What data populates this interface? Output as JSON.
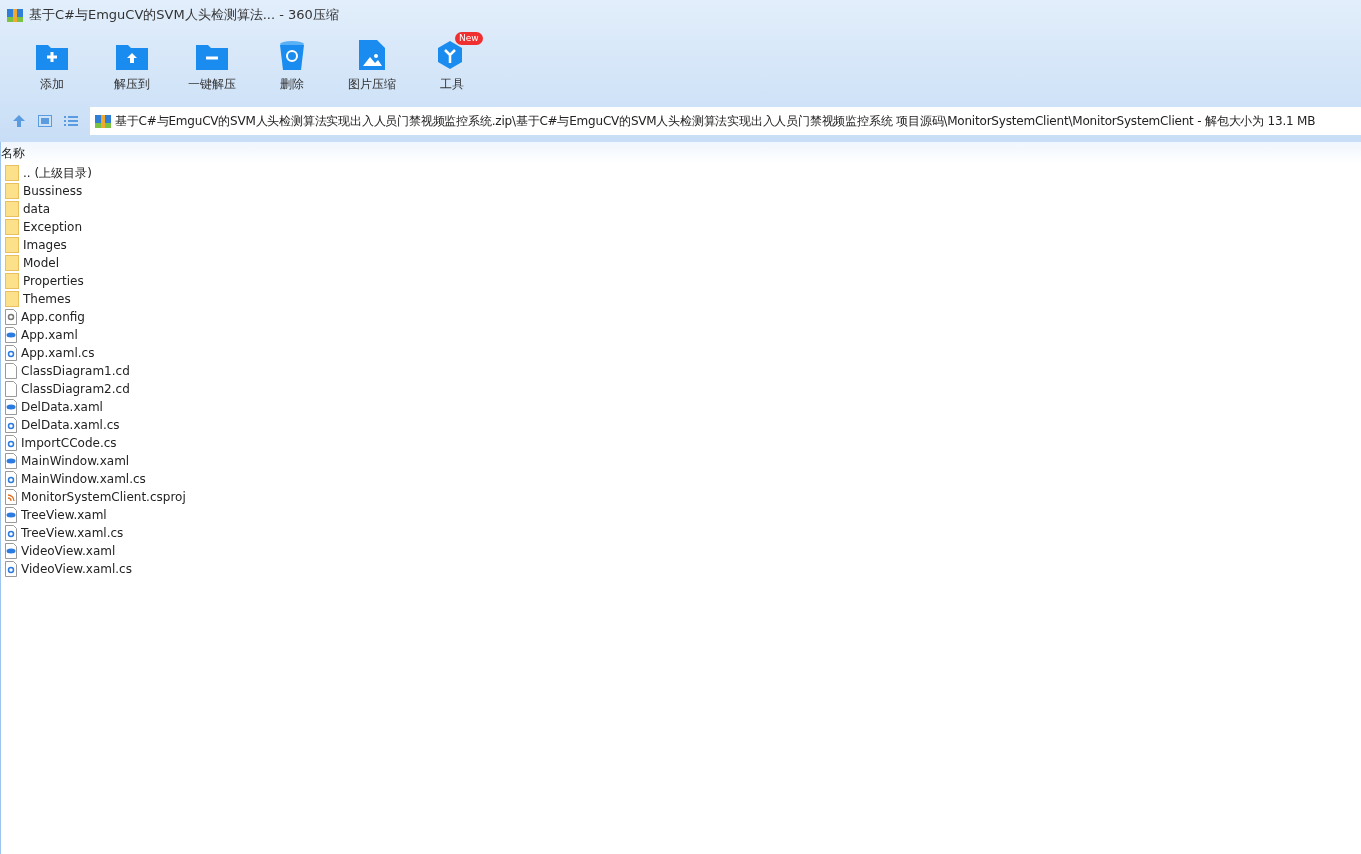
{
  "window": {
    "title": "基于C#与EmguCV的SVM人头检测算法... - 360压缩"
  },
  "toolbar": [
    {
      "kind": "add",
      "label": "添加"
    },
    {
      "kind": "extract",
      "label": "解压到"
    },
    {
      "kind": "oneclick",
      "label": "一键解压"
    },
    {
      "kind": "delete",
      "label": "删除"
    },
    {
      "kind": "image",
      "label": "图片压缩"
    },
    {
      "kind": "tools",
      "label": "工具",
      "badge": "New"
    }
  ],
  "address": {
    "path": "基于C#与EmguCV的SVM人头检测算法实现出入人员门禁视频监控系统.zip\\基于C#与EmguCV的SVM人头检测算法实现出入人员门禁视频监控系统 项目源码\\MonitorSystemClient\\MonitorSystemClient - 解包大小为 13.1 MB"
  },
  "table": {
    "columns": [
      "名称"
    ],
    "rows": [
      {
        "kind": "folder",
        "name": ".. (上级目录)"
      },
      {
        "kind": "folder",
        "name": "Bussiness"
      },
      {
        "kind": "folder",
        "name": "data"
      },
      {
        "kind": "folder",
        "name": "Exception"
      },
      {
        "kind": "folder",
        "name": "Images"
      },
      {
        "kind": "folder",
        "name": "Model"
      },
      {
        "kind": "folder",
        "name": "Properties"
      },
      {
        "kind": "folder",
        "name": "Themes"
      },
      {
        "kind": "config",
        "name": "App.config"
      },
      {
        "kind": "xaml",
        "name": "App.xaml"
      },
      {
        "kind": "cs",
        "name": "App.xaml.cs"
      },
      {
        "kind": "blank",
        "name": "ClassDiagram1.cd"
      },
      {
        "kind": "blank",
        "name": "ClassDiagram2.cd"
      },
      {
        "kind": "xaml",
        "name": "DelData.xaml"
      },
      {
        "kind": "cs",
        "name": "DelData.xaml.cs"
      },
      {
        "kind": "cs",
        "name": "ImportCCode.cs"
      },
      {
        "kind": "xaml",
        "name": "MainWindow.xaml"
      },
      {
        "kind": "cs",
        "name": "MainWindow.xaml.cs"
      },
      {
        "kind": "csproj",
        "name": "MonitorSystemClient.csproj"
      },
      {
        "kind": "xaml",
        "name": "TreeView.xaml"
      },
      {
        "kind": "cs",
        "name": "TreeView.xaml.cs"
      },
      {
        "kind": "xaml",
        "name": "VideoView.xaml"
      },
      {
        "kind": "cs",
        "name": "VideoView.xaml.cs"
      }
    ]
  }
}
